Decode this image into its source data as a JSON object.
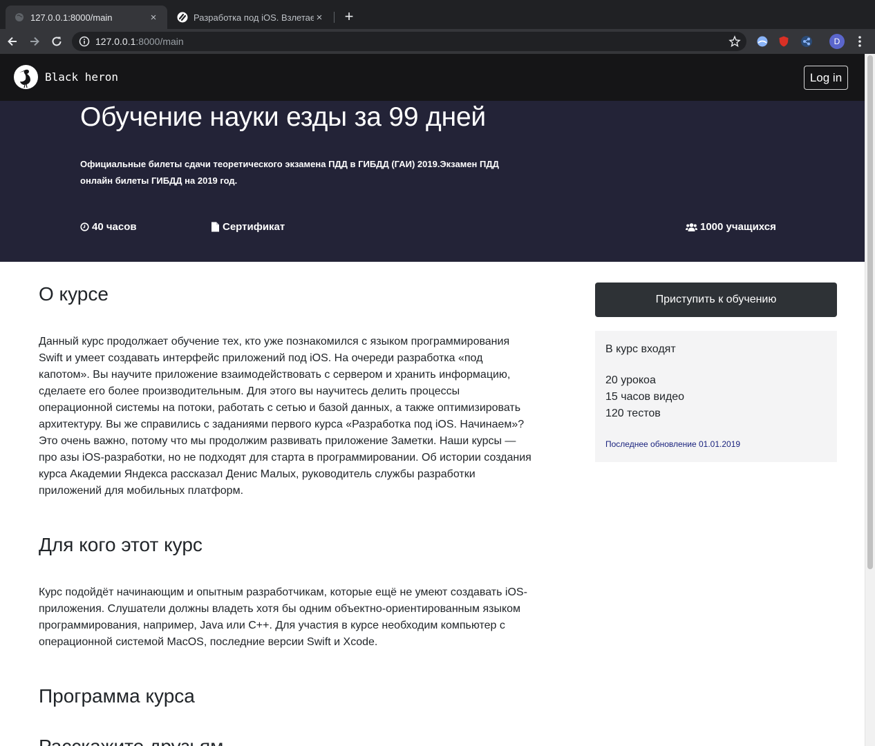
{
  "browser": {
    "tabs": [
      {
        "title": "127.0.0.1:8000/main",
        "active": true
      },
      {
        "title": "Разработка под iOS. Взлетаем",
        "active": false
      }
    ],
    "url_host": "127.0.0.1",
    "url_rest": ":8000/main",
    "profile_initial": "D",
    "new_tab_symbol": "+",
    "close_symbol": "×"
  },
  "navbar": {
    "brand_name": "Black heron",
    "login_label": "Log in"
  },
  "hero": {
    "title": "Обучение науки езды за 99 дней",
    "description": "Официальные билеты сдачи теоретического экзамена ПДД в ГИБДД (ГАИ) 2019.Экзамен ПДД онлайн билеты ГИБДД на 2019 год.",
    "duration": "40 часов",
    "certificate": "Сертификат",
    "students": "1000 учащихся"
  },
  "content": {
    "about_title": "О курсе",
    "about_text": "Данный курс продолжает обучение тех, кто уже познакомился с языком программирования Swift и умеет создавать интерфейс приложений под iOS. На очереди разработка «под капотом». Вы научите приложение взаимодействовать с сервером и хранить информацию, сделаете его более производительным. Для этого вы научитесь делить процессы операционной системы на потоки, работать с сетью и базой данных, а также оптимизировать архитектуру. Вы же справились с заданиями первого курса «Разработка под iOS. Начинаем»? Это очень важно, потому что мы продолжим развивать приложение Заметки. Наши курсы — про азы iOS-разработки, но не подходят для старта в программировании. Об истории создания курса Академии Яндекса рассказал Денис Малых, руководитель службы разработки приложений для мобильных платформ.",
    "audience_title": "Для кого этот курс",
    "audience_text": "Курс подойдёт начинающим и опытным разработчикам, которые ещё не умеют создавать iOS-приложения. Слушатели должны владеть хотя бы одним объектно-ориентированным языком программирования, например, Java или C++. Для участия в курсе необходим компьютер с операционной системой MacOS, последние версии Swift и Xcode.",
    "program_title": "Программа курса",
    "share_title": "Расскажите друзьям"
  },
  "sidebar": {
    "start_label": "Приступить к обучению",
    "includes_title": "В курс входят",
    "items": [
      "20 урокоа",
      "15 часов видео",
      "120 тестов"
    ],
    "updated": "Последнее обновление 01.01.2019"
  },
  "icons": {
    "duration": "clock-icon",
    "certificate": "file-icon",
    "students": "users-icon",
    "brand": "heron-logo"
  },
  "colors": {
    "navbar_bg": "#151517",
    "hero_bg": "#232337",
    "button_bg": "#2e3236",
    "card_bg": "#f4f4f5",
    "updated_text": "#1a237e"
  }
}
